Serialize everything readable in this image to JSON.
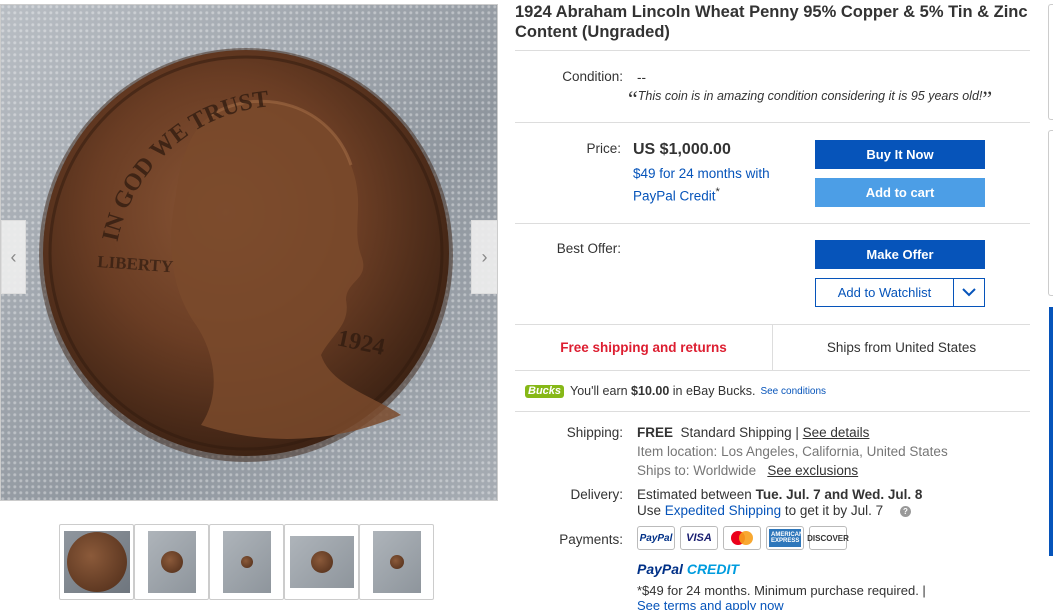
{
  "listing": {
    "title": "1924 Abraham Lincoln Wheat Penny 95% Copper & 5% Tin & Zinc Content (Ungraded)"
  },
  "gallery": {
    "coin_inscriptions": {
      "motto": "IN GOD WE TRUST",
      "liberty": "LIBERTY",
      "year": "1924"
    },
    "prev_icon": "chevron-left-icon",
    "next_icon": "chevron-right-icon",
    "thumbnails": [
      {
        "name": "thumbnail-1",
        "selected": true
      },
      {
        "name": "thumbnail-2",
        "selected": false
      },
      {
        "name": "thumbnail-3",
        "selected": false
      },
      {
        "name": "thumbnail-4",
        "selected": false
      },
      {
        "name": "thumbnail-5",
        "selected": false
      }
    ]
  },
  "condition": {
    "label": "Condition:",
    "value": "--",
    "quote": "This coin is in amazing condition considering it is 95 years old!",
    "open_quote": "“",
    "close_quote": "”"
  },
  "price": {
    "label": "Price:",
    "value": "US $1,000.00",
    "credit_text": "$49 for 24 months with PayPal Credit",
    "credit_mark": "*"
  },
  "buttons": {
    "buy_now": "Buy It Now",
    "add_to_cart": "Add to cart",
    "make_offer": "Make Offer",
    "add_to_watchlist": "Add to Watchlist",
    "watchlist_dropdown_icon": "chevron-down-icon"
  },
  "best_offer": {
    "label": "Best Offer:"
  },
  "shipping_banner": {
    "free": "Free shipping and returns",
    "ships_from": "Ships from United States"
  },
  "bucks": {
    "logo": "Bucks",
    "text_pre": "You'll earn",
    "amount": "$10.00",
    "text_post": "in eBay Bucks.",
    "link": "See conditions"
  },
  "shipping": {
    "label": "Shipping:",
    "free": "FREE",
    "method": "Standard Shipping |",
    "details_link": "See details",
    "location_label": "Item location:",
    "location": "Los Angeles, California, United States",
    "ships_to_label": "Ships to:",
    "ships_to": "Worldwide",
    "exclusions_link": "See exclusions"
  },
  "delivery": {
    "label": "Delivery:",
    "text": "Estimated between",
    "dates": "Tue. Jul. 7 and Wed. Jul. 8",
    "use": "Use",
    "expedited_link": "Expedited Shipping",
    "get_by": "to get it by Jul. 7",
    "help": "?"
  },
  "payments": {
    "label": "Payments:",
    "methods": [
      "PayPal",
      "VISA",
      "Mastercard",
      "AMERICAN EXPRESS",
      "DISCOVER"
    ],
    "paypal_credit_a": "PayPal",
    "paypal_credit_b": "CREDIT",
    "fine_print": "*$49 for 24 months. Minimum purchase required.  |",
    "terms_link": "See terms and apply now"
  },
  "colors": {
    "primary": "#0654ba",
    "secondary": "#4c9ee6",
    "free_red": "#dd1e31",
    "bucks_green": "#86b817"
  }
}
